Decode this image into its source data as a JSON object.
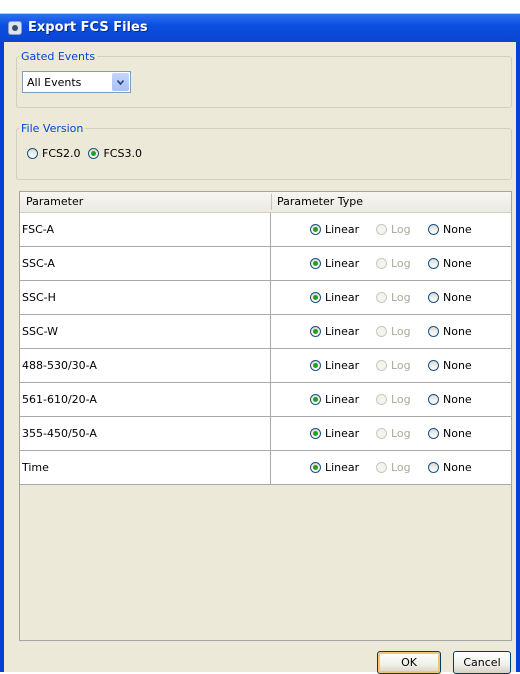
{
  "window": {
    "title": "Export FCS Files"
  },
  "gated_events": {
    "legend": "Gated Events",
    "selected": "All Events"
  },
  "file_version": {
    "legend": "File Version",
    "options": [
      {
        "label": "FCS2.0",
        "checked": false
      },
      {
        "label": "FCS3.0",
        "checked": true
      }
    ]
  },
  "table": {
    "headers": {
      "parameter": "Parameter",
      "parameter_type": "Parameter Type"
    },
    "type_labels": {
      "linear": "Linear",
      "log": "Log",
      "none": "None"
    },
    "rows": [
      {
        "name": "FSC-A",
        "type": "Linear"
      },
      {
        "name": "SSC-A",
        "type": "Linear"
      },
      {
        "name": "SSC-H",
        "type": "Linear"
      },
      {
        "name": "SSC-W",
        "type": "Linear"
      },
      {
        "name": "488-530/30-A",
        "type": "Linear"
      },
      {
        "name": "561-610/20-A",
        "type": "Linear"
      },
      {
        "name": "355-450/50-A",
        "type": "Linear"
      },
      {
        "name": "Time",
        "type": "Linear"
      }
    ]
  },
  "buttons": {
    "ok": "OK",
    "cancel": "Cancel"
  },
  "colors": {
    "title_bar": "#0b4fe0",
    "legend_text": "#0046d5",
    "radio_checked": "#21a121",
    "dialog_bg": "#ece9d8"
  }
}
